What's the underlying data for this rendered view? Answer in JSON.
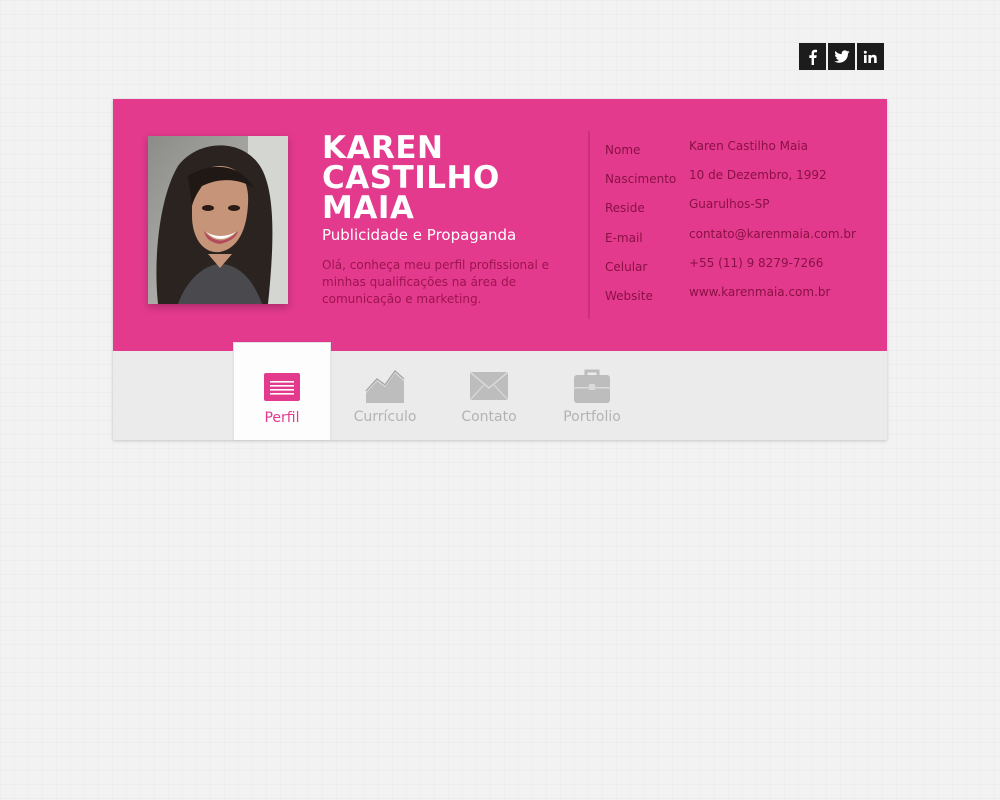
{
  "social": [
    {
      "name": "facebook",
      "glyph": "f"
    },
    {
      "name": "twitter",
      "glyph": "t"
    },
    {
      "name": "linkedin",
      "glyph": "in"
    }
  ],
  "profile": {
    "name_lines": [
      "KAREN",
      "CASTILHO",
      "MAIA"
    ],
    "profession": "Publicidade e Propaganda",
    "intro": "Olá, conheça meu perfil profissional e minhas qualificações na área de comunicação e marketing."
  },
  "info": [
    {
      "label": "Nome",
      "value": "Karen Castilho Maia"
    },
    {
      "label": "Nascimento",
      "value": "10 de Dezembro, 1992"
    },
    {
      "label": "Reside",
      "value": "Guarulhos-SP"
    },
    {
      "label": "E-mail",
      "value": "contato@karenmaia.com.br"
    },
    {
      "label": "Celular",
      "value": "+55 (11) 9 8279-7266"
    },
    {
      "label": "Website",
      "value": "www.karenmaia.com.br"
    }
  ],
  "nav": [
    {
      "label": "Perfil",
      "icon": "profile-icon",
      "active": true
    },
    {
      "label": "Currículo",
      "icon": "chart-icon",
      "active": false
    },
    {
      "label": "Contato",
      "icon": "envelope-icon",
      "active": false
    },
    {
      "label": "Portfolio",
      "icon": "briefcase-icon",
      "active": false
    }
  ],
  "colors": {
    "accent": "#e33a8d",
    "info_text": "#8a1146",
    "nav_bg": "#ebebeb",
    "nav_inactive": "#b3b3b3"
  }
}
